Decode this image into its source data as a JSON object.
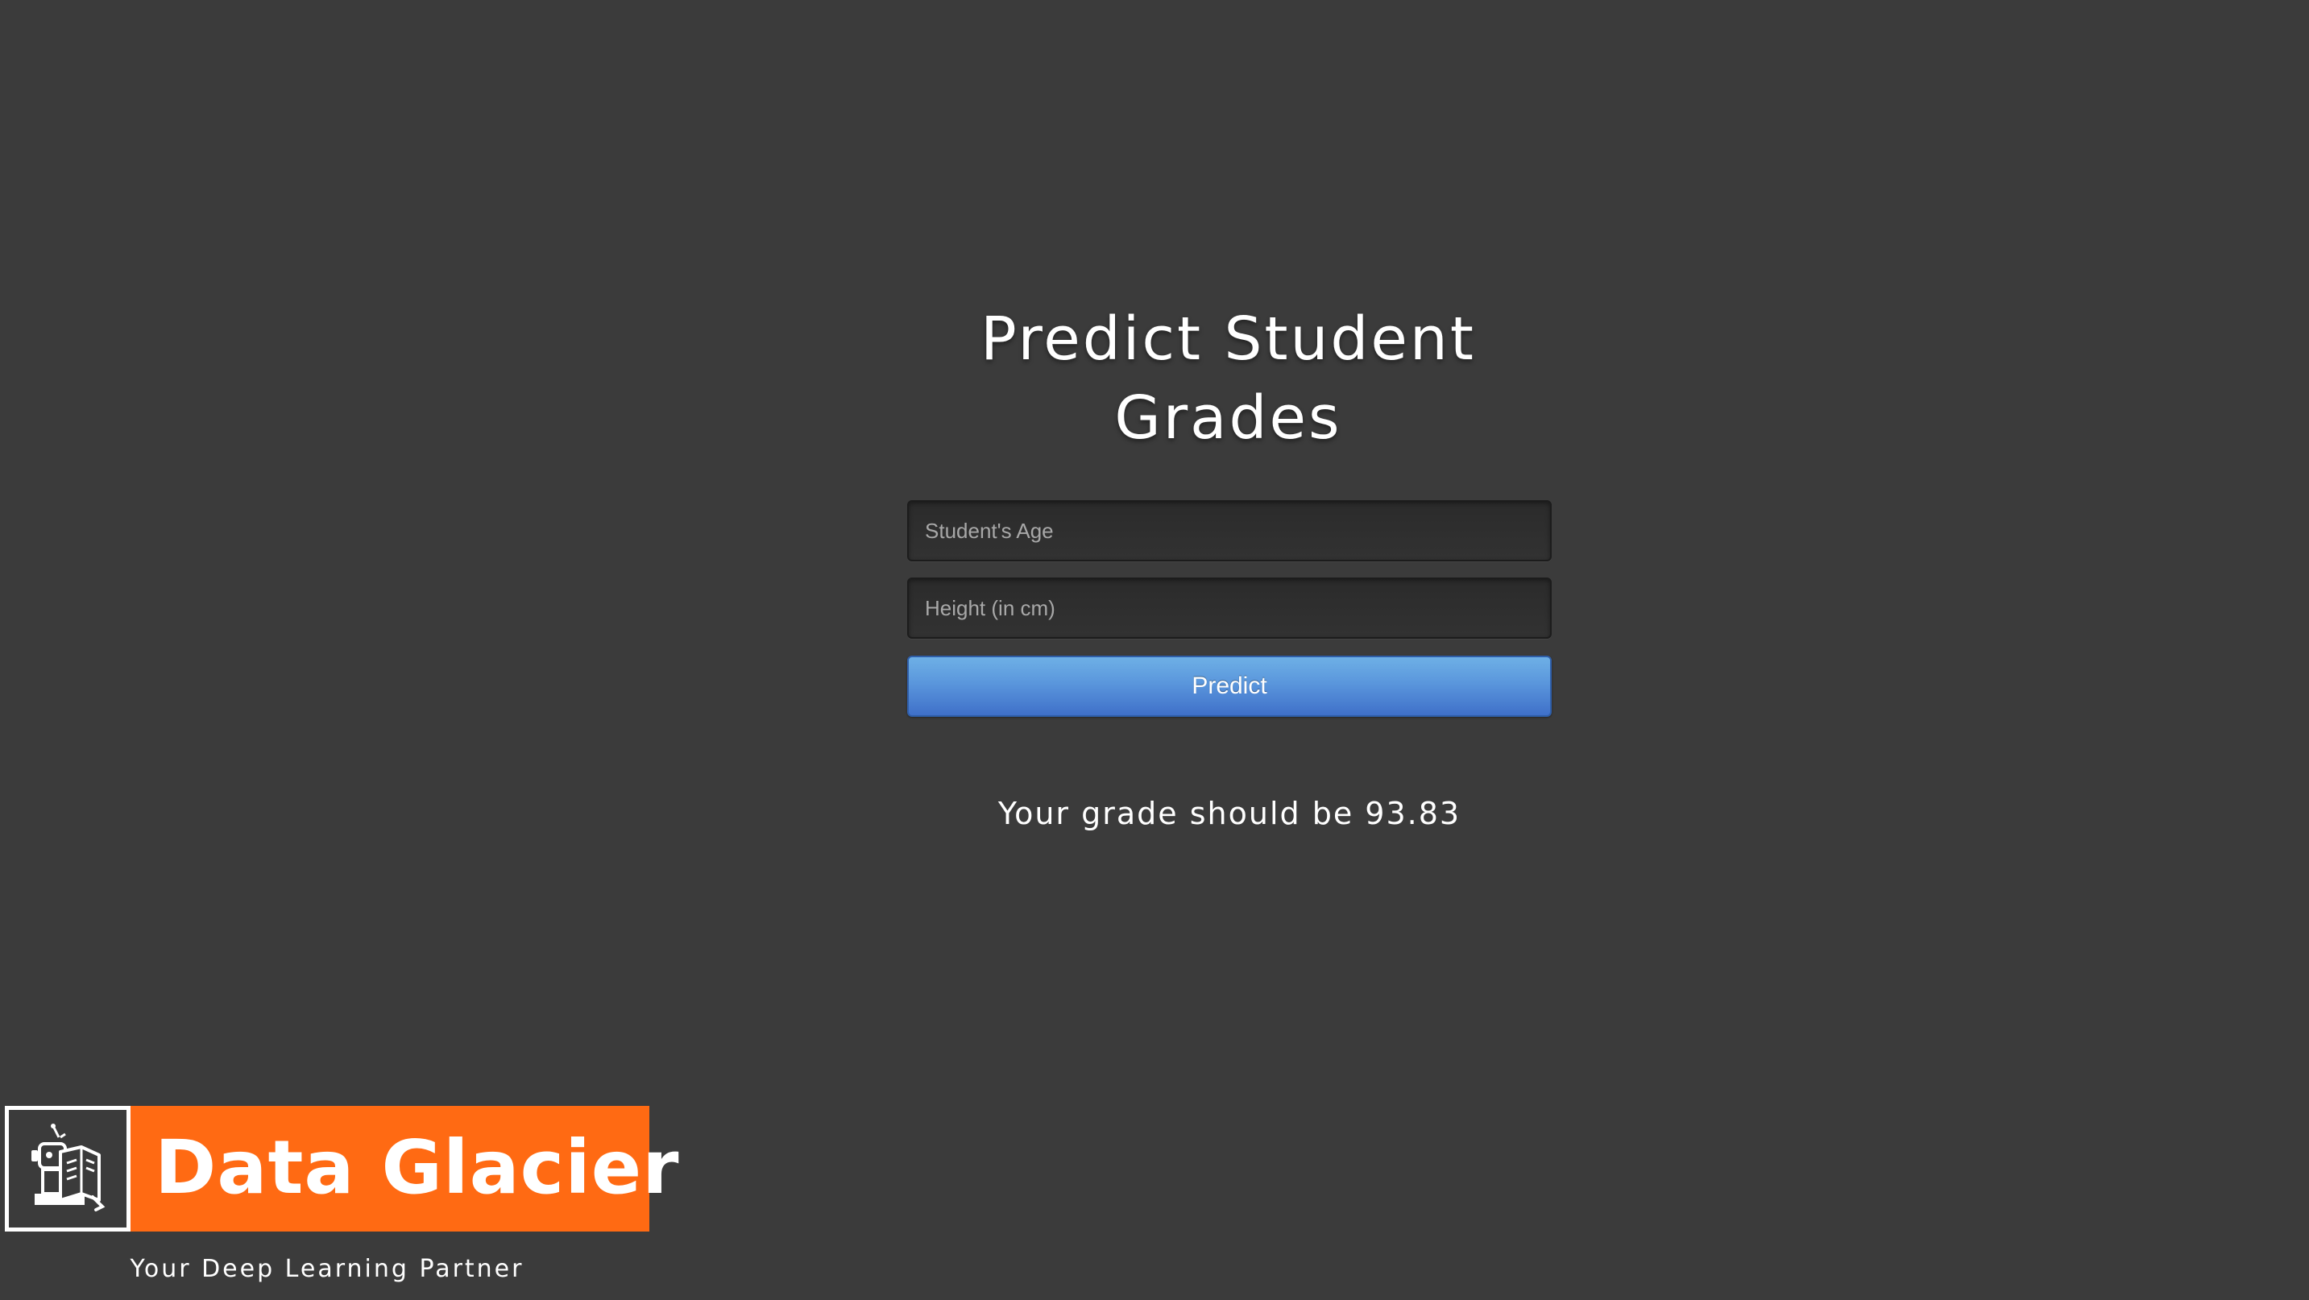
{
  "page": {
    "title": "Predict Student Grades",
    "background_color": "#3b3b3b"
  },
  "form": {
    "age_placeholder": "Student's Age",
    "age_value": "",
    "height_placeholder": "Height (in cm)",
    "height_value": "",
    "predict_label": "Predict",
    "button_color": "#5a96dc"
  },
  "result": {
    "text": "Your grade should be 93.83"
  },
  "brand": {
    "name": "Data Glacier",
    "tagline": "Your Deep Learning Partner",
    "logo_icon": "robot-reading-book-icon",
    "color": "#ff6a13"
  }
}
